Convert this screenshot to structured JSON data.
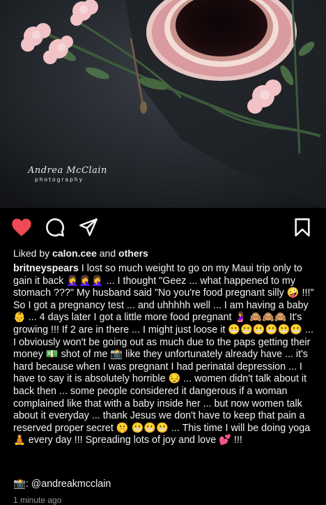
{
  "photo": {
    "watermark_name": "Andrea McClain",
    "watermark_sub": "photography"
  },
  "actions": {
    "like_icon": "heart-filled-icon",
    "comment_icon": "comment-icon",
    "share_icon": "send-icon",
    "save_icon": "bookmark-icon",
    "like_color": "#ed4956"
  },
  "likes": {
    "prefix": "Liked by ",
    "user": "calon.cee",
    "middle": " and ",
    "others": "others"
  },
  "post": {
    "username": "britneyspears",
    "caption": " I lost so much weight to go on my Maui trip only to gain it back 🤦‍♀️🤦‍♀️🤦‍♀️ ... I thought \"Geez ... what happened to my stomach ???\" My husband said \"No you're food pregnant silly 🤪 !!!\" So I got a pregnancy test ... and uhhhhh well ... I am having a baby 👶 ... 4 days later I got a little more food pregnant 🤰 🙈🙈🙈 It's growing !!! If 2 are in there ... I might just loose it 😬😬😬😬😬😬 ... I obviously won't be going out as much due to the paps getting their money 💵 shot of me 📸 like they unfortunately already have ... it's hard because when I was pregnant I had perinatal depression ... I have to say it is absolutely horrible 😔 ... women didn't talk about it back then ... some people considered it dangerous if a woman complained like that with a baby inside her ... but now women talk about it everyday ... thank Jesus we don't have to keep that pain a reserved proper secret 🤫 😬😬😬 ... This time I will be doing yoga 🧘 every day !!! Spreading lots of joy and love 💕 !!!",
    "credit": "📸: @andreakmcclain",
    "timestamp": "1 minute ago"
  }
}
